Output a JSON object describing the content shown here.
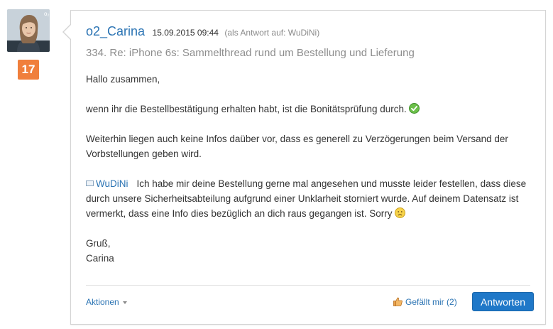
{
  "avatar": {
    "badge_glyph": "o₂"
  },
  "rank": {
    "value": "17",
    "color": "#f07f3c"
  },
  "post": {
    "author": "o2_Carina",
    "date": "15.09.2015 09:44",
    "reply_to": "(als Antwort auf: WuDiNi)",
    "subject": "334. Re: iPhone 6s: Sammelthread rund um Bestellung und Lieferung",
    "body": {
      "greeting": "Hallo zusammen,",
      "p1": "wenn ihr die Bestellbestätigung erhalten habt, ist die Bonitätsprüfung durch.",
      "p2": "Weiterhin liegen auch keine Infos daüber vor, dass es generell zu Verzögerungen beim Versand der Vorbstellungen geben wird.",
      "mention_user": "WuDiNi",
      "p3": "Ich habe mir deine Bestellung gerne mal angesehen und musste leider festellen, dass diese durch unsere Sicherheitsabteilung aufgrund einer Unklarheit storniert wurde. Auf deinem Datensatz ist vermerkt, dass eine Info dies bezüglich an dich raus gegangen ist. Sorry",
      "closing": "Gruß,",
      "signature": "Carina"
    },
    "icons": {
      "p1_emoji": "check-emoji-icon",
      "p3_emoji": "sad-emoji-icon",
      "mention": "user-mention-icon",
      "like": "thumbs-up-icon"
    }
  },
  "footer": {
    "actions_label": "Aktionen",
    "like_label": "Gefällt mir",
    "like_count": "(2)",
    "reply_label": "Antworten"
  },
  "colors": {
    "link": "#2a73b3",
    "primary_button": "#1f78c8",
    "subject": "#8d8d8d"
  }
}
